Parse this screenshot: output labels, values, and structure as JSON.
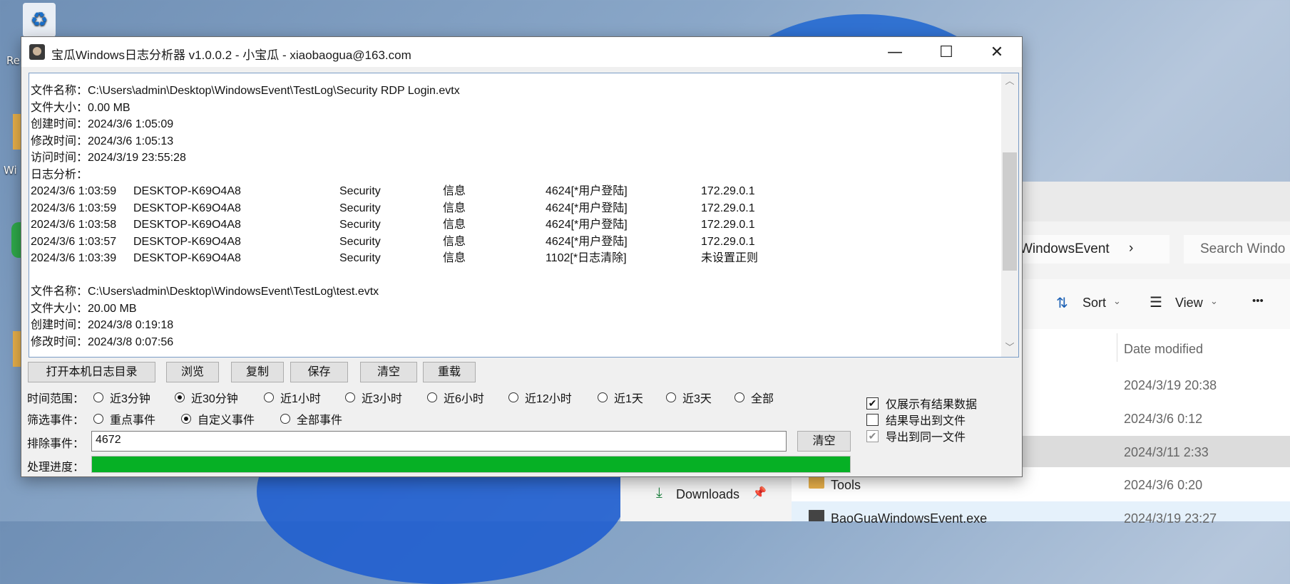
{
  "window": {
    "title": "宝瓜Windows日志分析器 v1.0.0.2 - 小宝瓜 - xiaobaogua@163.com",
    "minimize": "—",
    "maximize": "☐",
    "close": "✕"
  },
  "log": {
    "file1": {
      "name": "文件名称：C:\\Users\\admin\\Desktop\\WindowsEvent\\TestLog\\Security RDP Login.evtx",
      "size": "文件大小：0.00 MB",
      "created": "创建时间：2024/3/6 1:05:09",
      "modified": "修改时间：2024/3/6 1:05:13",
      "accessed": "访问时间：2024/3/19 23:55:28",
      "analysis": "日志分析："
    },
    "events": [
      {
        "time": "2024/3/6 1:03:59",
        "host": "DESKTOP-K69O4A8",
        "source": "Security",
        "level": "信息",
        "event": "4624[*用户登陆]",
        "ip": "172.29.0.1"
      },
      {
        "time": "2024/3/6 1:03:59",
        "host": "DESKTOP-K69O4A8",
        "source": "Security",
        "level": "信息",
        "event": "4624[*用户登陆]",
        "ip": "172.29.0.1"
      },
      {
        "time": "2024/3/6 1:03:58",
        "host": "DESKTOP-K69O4A8",
        "source": "Security",
        "level": "信息",
        "event": "4624[*用户登陆]",
        "ip": "172.29.0.1"
      },
      {
        "time": "2024/3/6 1:03:57",
        "host": "DESKTOP-K69O4A8",
        "source": "Security",
        "level": "信息",
        "event": "4624[*用户登陆]",
        "ip": "172.29.0.1"
      },
      {
        "time": "2024/3/6 1:03:39",
        "host": "DESKTOP-K69O4A8",
        "source": "Security",
        "level": "信息",
        "event": "1102[*日志清除]",
        "ip": "未设置正则"
      }
    ],
    "file2": {
      "name": "文件名称：C:\\Users\\admin\\Desktop\\WindowsEvent\\TestLog\\test.evtx",
      "size": "文件大小：20.00 MB",
      "created": "创建时间：2024/3/8 0:19:18",
      "modified": "修改时间：2024/3/8 0:07:56"
    }
  },
  "buttons": {
    "open_dir": "打开本机日志目录",
    "browse": "浏览",
    "copy": "复制",
    "save": "保存",
    "clear": "清空",
    "reload": "重载",
    "clear_exclude": "清空"
  },
  "time_range": {
    "label": "时间范围：",
    "options": [
      "近3分钟",
      "近30分钟",
      "近1小时",
      "近3小时",
      "近6小时",
      "近12小时",
      "近1天",
      "近3天",
      "全部"
    ],
    "selected": "近30分钟"
  },
  "filter": {
    "label": "筛选事件：",
    "options": [
      "重点事件",
      "自定义事件",
      "全部事件"
    ],
    "selected": "自定义事件"
  },
  "exclude": {
    "label": "排除事件：",
    "value": "4672"
  },
  "progress": {
    "label": "处理进度：",
    "percent": 100,
    "color": "#06b025"
  },
  "checks": {
    "only_results": {
      "label": "仅展示有结果数据",
      "checked": true
    },
    "export_file": {
      "label": "结果导出到文件",
      "checked": false
    },
    "same_file": {
      "label": "导出到同一文件",
      "checked": true
    }
  },
  "explorer": {
    "address": "WindowsEvent",
    "search_placeholder": "Search Windo",
    "sort": "Sort",
    "view": "View",
    "more": "•••",
    "date_header": "Date modified",
    "dates": [
      "2024/3/19 20:38",
      "2024/3/6 0:12",
      "2024/3/11 2:33",
      "2024/3/6 0:20",
      "2024/3/19 23:27"
    ],
    "tools": "Tools",
    "exe": "BaoGuaWindowsEvent.exe",
    "downloads": "Downloads"
  },
  "desktop": {
    "icon_label_1": "Re",
    "icon_label_2": "Wi"
  }
}
